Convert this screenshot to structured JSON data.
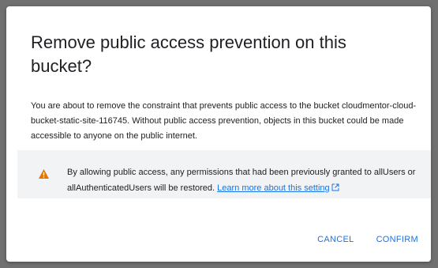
{
  "dialog": {
    "title": "Remove public access prevention on this bucket?",
    "body": "You are about to remove the constraint that prevents public access to the bucket cloudmentor-cloud-bucket-static-site-116745. Without public access prevention, objects in this bucket could be made accessible to anyone on the public internet.",
    "warning": {
      "icon": "warning-icon",
      "text": "By allowing public access, any permissions that had been previously granted to allUsers or allAuthenticatedUsers will be restored. ",
      "link_label": "Learn more about this setting",
      "link_icon": "open-in-new-icon"
    },
    "actions": {
      "cancel_label": "CANCEL",
      "confirm_label": "CONFIRM"
    }
  },
  "colors": {
    "accent": "#1a73e8",
    "warning": "#e37400",
    "backdrop": "#707070"
  }
}
